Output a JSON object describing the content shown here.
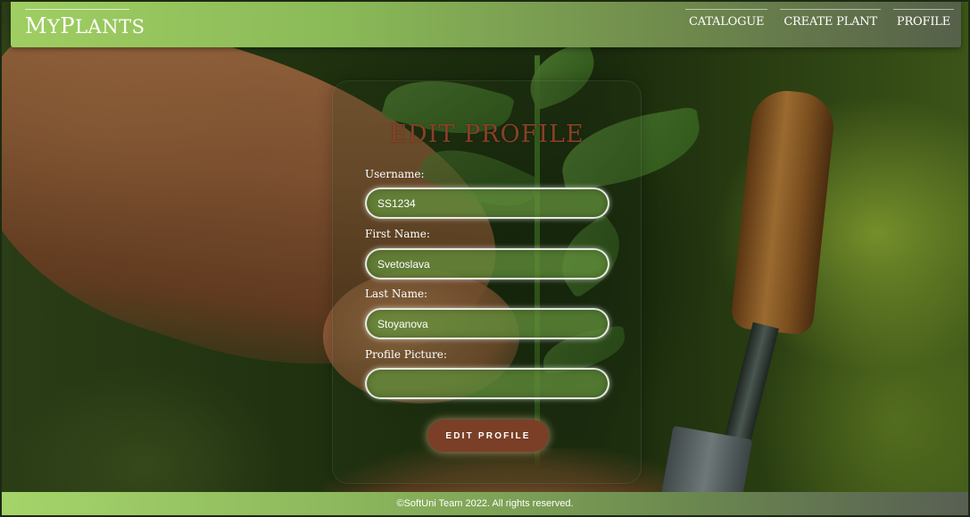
{
  "nav": {
    "logo_first": "M",
    "logo_rest": "Y",
    "logo_second": "P",
    "logo_last": "LANTS",
    "links": [
      "CATALOGUE",
      "CREATE PLANT",
      "PROFILE"
    ]
  },
  "form": {
    "title": "EDIT PROFILE",
    "fields": [
      {
        "label": "Username:",
        "value": "SS1234"
      },
      {
        "label": "First Name:",
        "value": "Svetoslava"
      },
      {
        "label": "Last Name:",
        "value": "Stoyanova"
      },
      {
        "label": "Profile Picture:",
        "value": ""
      }
    ],
    "submit_label": "EDIT PROFILE"
  },
  "footer": {
    "text": "©SoftUni Team 2022. All rights reserved."
  },
  "colors": {
    "nav_start": "#9fce62",
    "title": "#8a3f28",
    "button": "#7a3f26"
  }
}
